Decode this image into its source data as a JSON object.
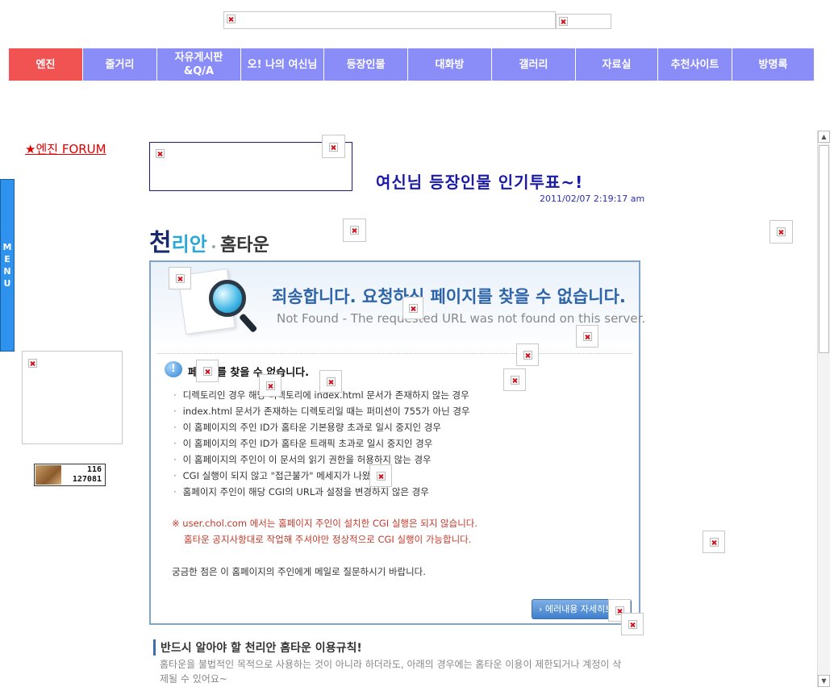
{
  "nav": {
    "items": [
      {
        "label": "엔진",
        "active": true
      },
      {
        "label": "줄거리"
      },
      {
        "label": "자유게시판\n&Q/A"
      },
      {
        "label": "오! 나의 여신님"
      },
      {
        "label": "등장인물"
      },
      {
        "label": "대화방"
      },
      {
        "label": "갤러리"
      },
      {
        "label": "자료실"
      },
      {
        "label": "추천사이트"
      },
      {
        "label": "방명록"
      }
    ],
    "colors": {
      "default": "#8a8cf8",
      "active": "#f15252"
    }
  },
  "sidebar": {
    "forum_link": "★엔진 FORUM",
    "menu_tab": "MENU",
    "counter": {
      "today": "116",
      "total": "127081"
    }
  },
  "main": {
    "headline": "여신님 등장인물 인기투표~!",
    "datetime": "2011/02/07 2:19:17 am"
  },
  "logo": {
    "part1": "천",
    "part2": "리안",
    "part3": "홈타운"
  },
  "error": {
    "title": "죄송합니다. 요청하신 페이지를 찾을 수 없습니다.",
    "subtitle": "Not Found - The requested URL was not found on this server.",
    "heading": "페이지를 찾을 수 없습니다.",
    "reasons": [
      "디렉토리인 경우 해당 디렉토리에 index.html 문서가 존재하지 않는 경우",
      "index.html 문서가 존재하는 디렉토리일 때는 퍼미션이 755가 아닌 경우",
      "이 홈페이지의 주인 ID가 홈타운 기본용량 초과로 일시 중지인 경우",
      "이 홈페이지의 주인 ID가 홈타운 트래픽 초과로 일시 중지인 경우",
      "이 홈페이지의 주인이 이 문서의 읽기 권한을 허용하지 않는 경우",
      "CGI 실행이 되지 않고 \"접근불가\" 메세지가 나왔다면",
      "홈페이지 주인이 해당 CGI의 URL과 설정을 변경하지 않은 경우"
    ],
    "notice_line1": "※ user.chol.com 에서는 홈페이지 주인이 설치한 CGI 실행은 되지 않습니다.",
    "notice_line2": "홈타운 공지사항대로 작업해 주셔야만 정상적으로 CGI 실행이 가능합니다.",
    "contact": "궁금한 점은 이 홈페이지의 주인에게 메일로 질문하시기 바랍니다.",
    "details_button": "› 에러내용 자세히보기"
  },
  "rules": {
    "title": "반드시 알아야 할 천리안 홈타운 이용규칙!",
    "text": "홈타운을 불법적인 목적으로 사용하는 것이 아니라 하더라도, 아래의 경우에는 홈타운 이용이 제한되거나 계정이 삭제될 수 있어요~"
  },
  "icons": {
    "broken_image": "broken-image-icon",
    "info": "info-icon",
    "magnifier": "magnifier-icon",
    "scroll_up": "▲",
    "scroll_down": "▼"
  }
}
